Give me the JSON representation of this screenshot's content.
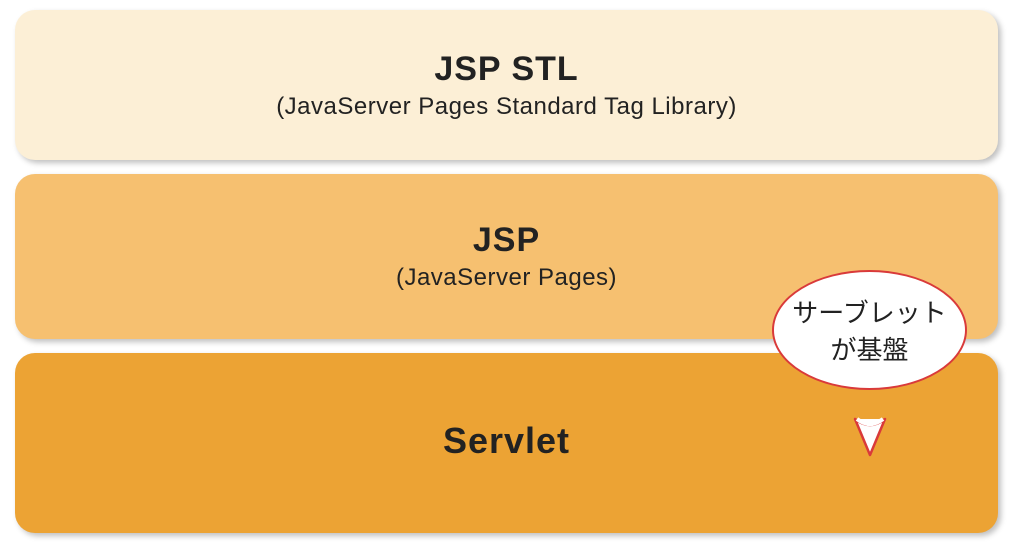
{
  "layers": [
    {
      "title": "JSP STL",
      "sub": "(JavaServer Pages Standard Tag Library)"
    },
    {
      "title": "JSP",
      "sub": "(JavaServer Pages)"
    },
    {
      "title": "Servlet",
      "sub": ""
    }
  ],
  "bubble": {
    "line1": "サーブレット",
    "line2": "が基盤"
  },
  "colors": {
    "layer_top": "#fcefd6",
    "layer_mid": "#f6c070",
    "layer_bot": "#eca334",
    "bubble_border": "#d93a3a"
  }
}
